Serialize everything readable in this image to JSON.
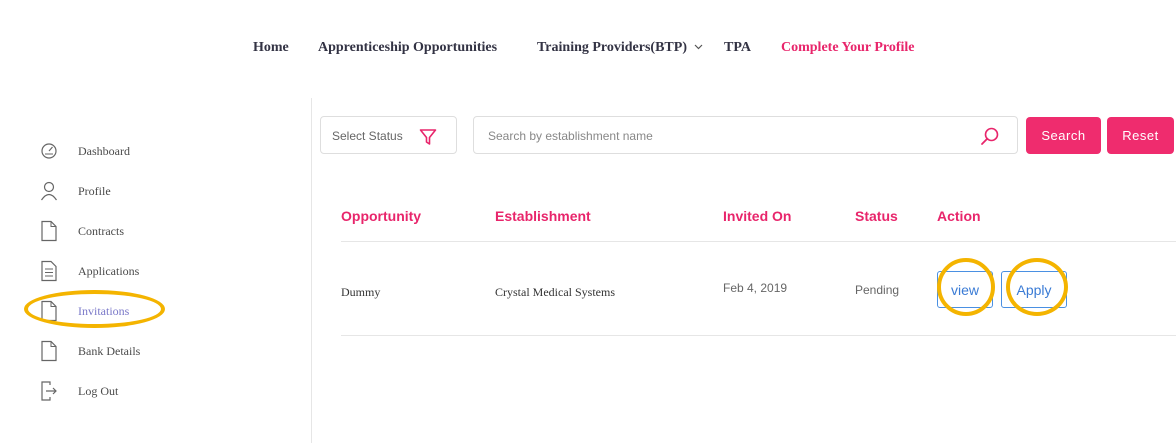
{
  "nav": {
    "home": "Home",
    "apprenticeship": "Apprenticeship Opportunities",
    "training_providers": "Training Providers(BTP)",
    "tpa": "TPA",
    "complete_profile": "Complete Your Profile"
  },
  "sidebar": {
    "items": [
      {
        "label": "Dashboard",
        "icon": "dashboard-icon"
      },
      {
        "label": "Profile",
        "icon": "user-icon"
      },
      {
        "label": "Contracts",
        "icon": "document-icon"
      },
      {
        "label": "Applications",
        "icon": "list-document-icon"
      },
      {
        "label": "Invitations",
        "icon": "document-icon",
        "active": true
      },
      {
        "label": "Bank Details",
        "icon": "document-icon"
      },
      {
        "label": "Log Out",
        "icon": "logout-icon"
      }
    ]
  },
  "filters": {
    "status_placeholder": "Select Status",
    "search_placeholder": "Search by establishment name",
    "search_label": "Search",
    "reset_label": "Reset"
  },
  "table": {
    "headers": [
      "Opportunity",
      "Establishment",
      "Invited On",
      "Status",
      "Action"
    ],
    "rows": [
      {
        "opportunity": "Dummy",
        "establishment": "Crystal Medical Systems",
        "invited_on": "Feb 4, 2019",
        "status": "Pending",
        "actions": [
          "view",
          "Apply"
        ]
      }
    ]
  },
  "colors": {
    "accent_pink": "#e8256b",
    "button_pink": "#ef2c6e",
    "link_blue": "#3a7bd5",
    "highlight_ring": "#f4b400",
    "active_sidebar": "#7a78c8"
  }
}
